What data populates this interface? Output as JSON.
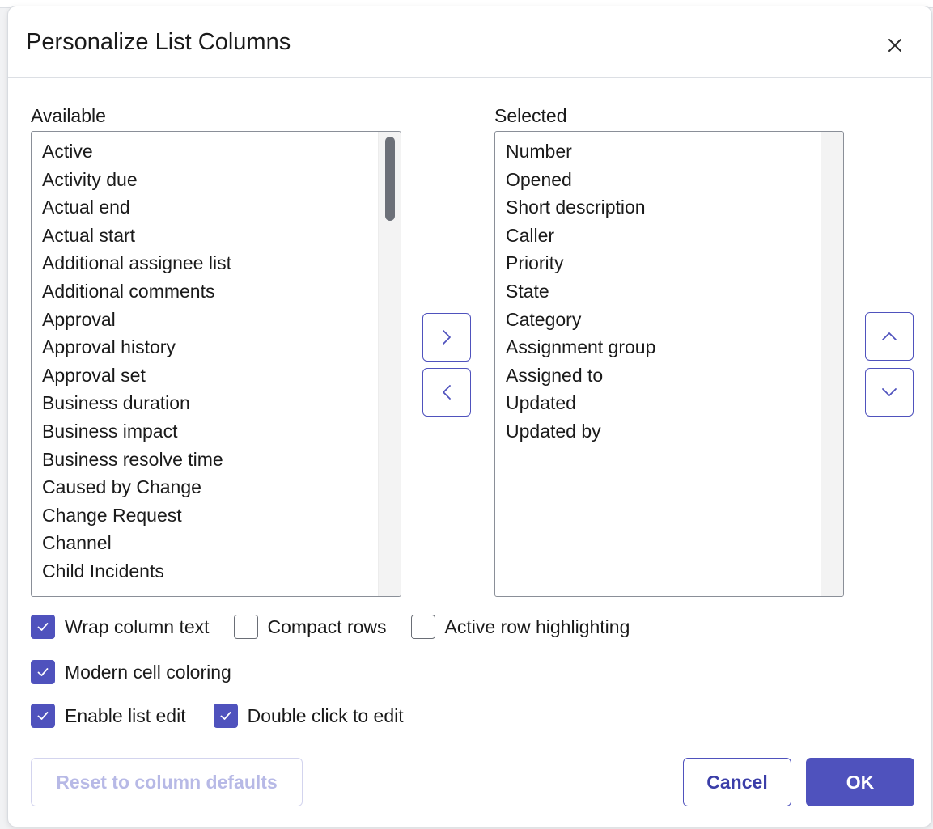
{
  "dialog": {
    "title": "Personalize List Columns",
    "close_label": "×"
  },
  "available": {
    "label": "Available",
    "items": [
      "Active",
      "Activity due",
      "Actual end",
      "Actual start",
      "Additional assignee list",
      "Additional comments",
      "Approval",
      "Approval history",
      "Approval set",
      "Business duration",
      "Business impact",
      "Business resolve time",
      "Caused by Change",
      "Change Request",
      "Channel",
      "Child Incidents"
    ]
  },
  "selected": {
    "label": "Selected",
    "items": [
      "Number",
      "Opened",
      "Short description",
      "Caller",
      "Priority",
      "State",
      "Category",
      "Assignment group",
      "Assigned to",
      "Updated",
      "Updated by"
    ]
  },
  "options": {
    "wrap_column_text": {
      "label": "Wrap column text",
      "checked": true
    },
    "compact_rows": {
      "label": "Compact rows",
      "checked": false
    },
    "active_row_highlighting": {
      "label": "Active row highlighting",
      "checked": false
    },
    "modern_cell_coloring": {
      "label": "Modern cell coloring",
      "checked": true
    },
    "enable_list_edit": {
      "label": "Enable list edit",
      "checked": true
    },
    "double_click_to_edit": {
      "label": "Double click to edit",
      "checked": true
    }
  },
  "buttons": {
    "reset": "Reset to column defaults",
    "cancel": "Cancel",
    "ok": "OK"
  },
  "icons": {
    "add": "chevron-right-icon",
    "remove": "chevron-left-icon",
    "move_up": "chevron-up-icon",
    "move_down": "chevron-down-icon",
    "close": "close-icon",
    "check": "check-icon"
  },
  "colors": {
    "accent": "#4f52bd",
    "disabled_text": "#b7b9e6",
    "disabled_border": "#d3d4ee",
    "scrollbar_thumb": "#6c7078"
  }
}
